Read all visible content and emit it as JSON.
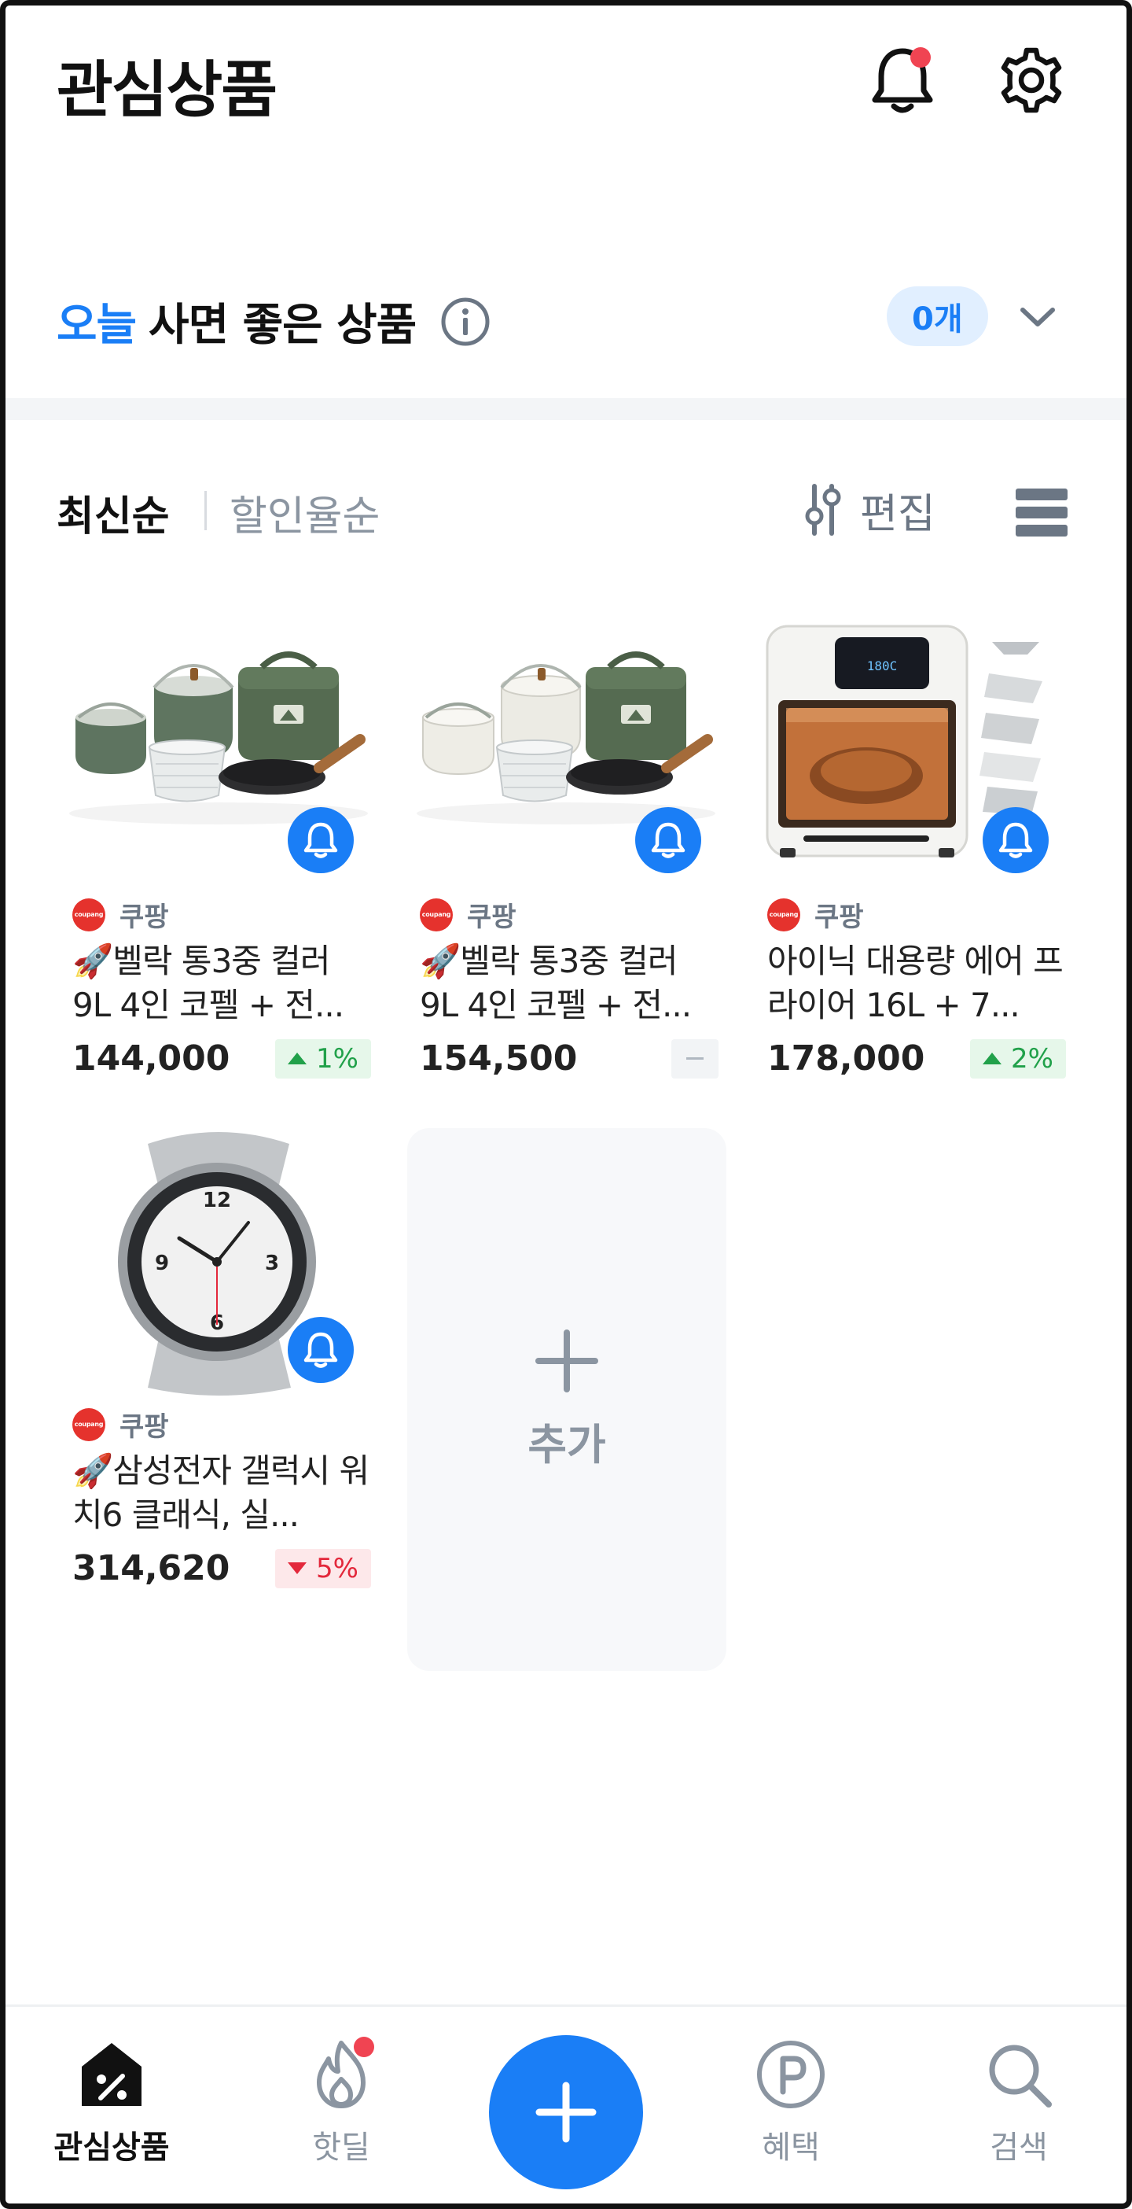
{
  "header": {
    "title": "관심상품"
  },
  "today": {
    "title_accent": "오늘",
    "title_rest": "사면 좋은 상품",
    "count_badge": "0개"
  },
  "sort": {
    "active": "최신순",
    "inactive": "할인율순",
    "edit_label": "편집"
  },
  "products": [
    {
      "store": "쿠팡",
      "store_logo_text": "coupang",
      "name": "🚀벨락 통3중 컬러 9L 4인 코펠 + 전...",
      "price": "144,000",
      "change": "1%",
      "direction": "up"
    },
    {
      "store": "쿠팡",
      "store_logo_text": "coupang",
      "name": "🚀벨락 통3중 컬러 9L 4인 코펠 + 전...",
      "price": "154,500",
      "change": "",
      "direction": "flat"
    },
    {
      "store": "쿠팡",
      "store_logo_text": "coupang",
      "name": "아이닉 대용량 에어 프라이어 16L + 7...",
      "price": "178,000",
      "change": "2%",
      "direction": "up"
    },
    {
      "store": "쿠팡",
      "store_logo_text": "coupang",
      "name": "🚀삼성전자 갤럭시 워치6 클래식, 실...",
      "price": "314,620",
      "change": "5%",
      "direction": "down"
    }
  ],
  "airfryer_display": "180C",
  "add_card": {
    "label": "추가"
  },
  "nav": {
    "items": [
      {
        "label": "관심상품",
        "icon": "tag-percent-icon",
        "active": true
      },
      {
        "label": "핫딜",
        "icon": "flame-icon",
        "active": false
      },
      {
        "label": "혜택",
        "icon": "point-icon",
        "active": false
      },
      {
        "label": "검색",
        "icon": "search-icon",
        "active": false
      }
    ],
    "fab_icon": "plus-icon"
  },
  "colors": {
    "accent": "#1a7ef6",
    "up": "#21a14a",
    "down": "#e3283b",
    "alert_dot": "#f04452"
  }
}
